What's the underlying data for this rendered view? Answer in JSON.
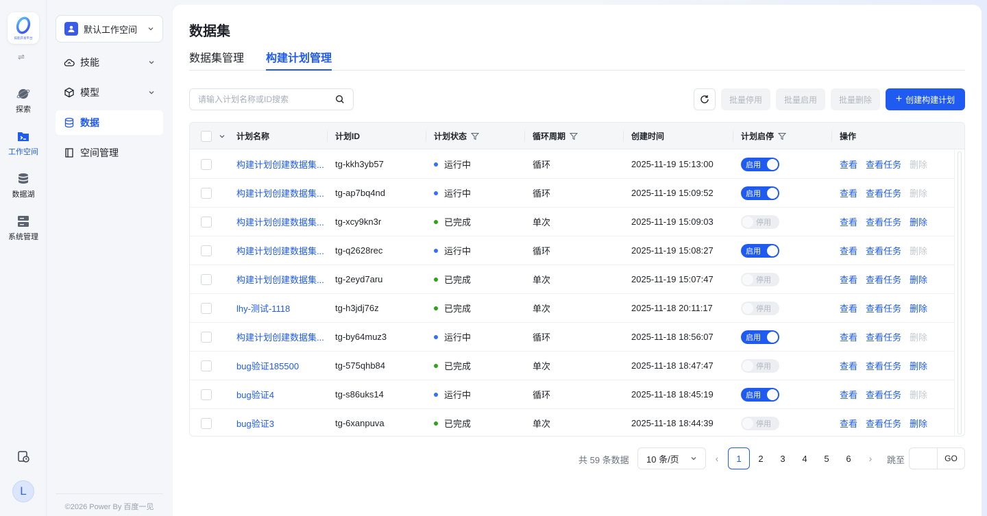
{
  "rail": {
    "logo_text": "技能开发平台",
    "items": [
      {
        "label": "探索",
        "icon": "planet-icon"
      },
      {
        "label": "工作空间",
        "icon": "terminal-folder-icon"
      },
      {
        "label": "数据湖",
        "icon": "database-icon"
      },
      {
        "label": "系统管理",
        "icon": "server-icon"
      }
    ],
    "avatar_letter": "L"
  },
  "sidebar": {
    "workspace_name": "默认工作空间",
    "items": [
      {
        "label": "技能",
        "icon": "cloud-icon"
      },
      {
        "label": "模型",
        "icon": "cube-icon"
      },
      {
        "label": "数据",
        "icon": "database-icon"
      },
      {
        "label": "空间管理",
        "icon": "book-icon"
      }
    ],
    "footer": "©2026 Power By 百度一见"
  },
  "page": {
    "title": "数据集",
    "tabs": [
      {
        "label": "数据集管理"
      },
      {
        "label": "构建计划管理"
      }
    ]
  },
  "toolbar": {
    "search_placeholder": "请输入计划名称或ID搜索",
    "batch_disable": "批量停用",
    "batch_enable": "批量启用",
    "batch_delete": "批量删除",
    "create": "创建构建计划"
  },
  "table": {
    "columns": {
      "name": "计划名称",
      "id": "计划ID",
      "status": "计划状态",
      "cycle": "循环周期",
      "created": "创建时间",
      "toggle": "计划启停",
      "actions": "操作"
    },
    "action_labels": {
      "view": "查看",
      "view_tasks": "查看任务",
      "delete": "删除"
    },
    "rows": [
      {
        "name": "构建计划创建数据集...",
        "id": "tg-kkh3yb57",
        "status": "运行中",
        "status_color": "#3370ff",
        "cycle": "循环",
        "created": "2025-11-19 15:13:00",
        "toggle": "启用",
        "on": true
      },
      {
        "name": "构建计划创建数据集...",
        "id": "tg-ap7bq4nd",
        "status": "运行中",
        "status_color": "#3370ff",
        "cycle": "循环",
        "created": "2025-11-19 15:09:52",
        "toggle": "启用",
        "on": true
      },
      {
        "name": "构建计划创建数据集...",
        "id": "tg-xcy9kn3r",
        "status": "已完成",
        "status_color": "#2aa515",
        "cycle": "单次",
        "created": "2025-11-19 15:09:03",
        "toggle": "停用",
        "on": false
      },
      {
        "name": "构建计划创建数据集...",
        "id": "tg-q2628rec",
        "status": "运行中",
        "status_color": "#3370ff",
        "cycle": "循环",
        "created": "2025-11-19 15:08:27",
        "toggle": "启用",
        "on": true
      },
      {
        "name": "构建计划创建数据集...",
        "id": "tg-2eyd7aru",
        "status": "已完成",
        "status_color": "#2aa515",
        "cycle": "单次",
        "created": "2025-11-19 15:07:47",
        "toggle": "停用",
        "on": false
      },
      {
        "name": "lhy-测试-1118",
        "id": "tg-h3jdj76z",
        "status": "已完成",
        "status_color": "#2aa515",
        "cycle": "单次",
        "created": "2025-11-18 20:11:17",
        "toggle": "停用",
        "on": false
      },
      {
        "name": "构建计划创建数据集...",
        "id": "tg-by64muz3",
        "status": "运行中",
        "status_color": "#3370ff",
        "cycle": "循环",
        "created": "2025-11-18 18:56:07",
        "toggle": "启用",
        "on": true
      },
      {
        "name": "bug验证185500",
        "id": "tg-575qhb84",
        "status": "已完成",
        "status_color": "#2aa515",
        "cycle": "单次",
        "created": "2025-11-18 18:47:47",
        "toggle": "停用",
        "on": false
      },
      {
        "name": "bug验证4",
        "id": "tg-s86uks14",
        "status": "运行中",
        "status_color": "#3370ff",
        "cycle": "循环",
        "created": "2025-11-18 18:45:19",
        "toggle": "启用",
        "on": true
      },
      {
        "name": "bug验证3",
        "id": "tg-6xanpuva",
        "status": "已完成",
        "status_color": "#2aa515",
        "cycle": "单次",
        "created": "2025-11-18 18:44:39",
        "toggle": "停用",
        "on": false
      }
    ]
  },
  "pagination": {
    "total_text": "共 59 条数据",
    "page_size": "10 条/页",
    "pages": [
      "1",
      "2",
      "3",
      "4",
      "5",
      "6"
    ],
    "current": "1",
    "jump_label": "跳至",
    "go": "GO"
  },
  "colors": {
    "accent": "#1f5bf0",
    "running": "#3370ff",
    "done": "#2aa515"
  }
}
